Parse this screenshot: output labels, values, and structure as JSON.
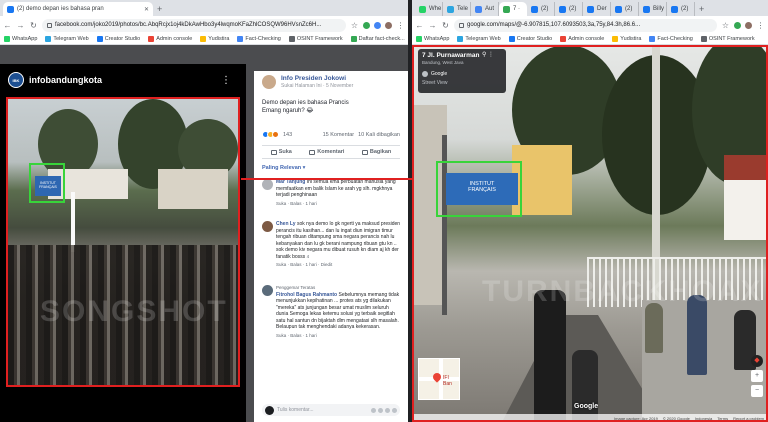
{
  "left_window": {
    "tabs": [
      {
        "label": "(2) demo depan ies bahasa pran",
        "active": true,
        "favicon_color": "#1877f2"
      }
    ],
    "url": "facebook.com/joko2019/photos/bc.AbqRcjx1oj4kDkAwHbo3y4lwqmoKFaZhlCOSQW96HVsnZc6H...",
    "bookmarks": [
      {
        "label": "WhatsApp",
        "color": "#25d366"
      },
      {
        "label": "Telegram Web",
        "color": "#2ca5e0"
      },
      {
        "label": "Creator Studio",
        "color": "#1877f2"
      },
      {
        "label": "Admin console",
        "color": "#ea4335"
      },
      {
        "label": "Yudistira",
        "color": "#fbbc05"
      },
      {
        "label": "Fact-Checking",
        "color": "#4285f4"
      },
      {
        "label": "OSINT Framework",
        "color": "#5f6368"
      },
      {
        "label": "Daftar fact-check...",
        "color": "#34a853"
      }
    ],
    "photo_page_name": "infobandungkota",
    "post": {
      "author": "Info Presiden Jokowi",
      "meta": "Sukai Halaman Ini · 5 November",
      "text_line1": "Demo depan ies bahasa Prancis",
      "text_line2": "Emang ngaruh? 😂",
      "reactions_count": "143",
      "comments_count": "15 Komentar",
      "shares_count": "10 Kali dibagikan",
      "action_like": "Suka",
      "action_comment": "Komentari",
      "action_share": "Bagikan",
      "sort_label": "Paling Relevan ▾",
      "comment_placeholder": "Tulis komentar..."
    },
    "comments": [
      {
        "name": "Mar Tanjung",
        "text": "Ini semua kma perbuatan manusia yang memfaatkan em balik Islam ke arah yg slh. mgkhnya terjadi penghinaan",
        "meta": "Suka · Balas · 1 hari"
      },
      {
        "name": "Chen Ly",
        "text": "sok nya demo lo gk ngerti ya maksud presiden perancis itu kasihan... dan lu ingat diun imigran timur tengah ribuan ditampung sma negara perancis nah lu kebanyakan dan lu gk berani nampung ribuan gtu kn .. sok demo kiv negara mu dibuat rusuh kn diam aj kh der fanatik bosss",
        "reacts": "4",
        "meta": "Suka · Balas · 1 hari · Diedit"
      },
      {
        "badge": "Penggemar Teratas",
        "name": "Fitrohol Bagus Rahmanto",
        "text": "Sebelumnya memang tidak menunjukkan kepihatinan ... protes ats yg dilakukan \"mereka\" ats junjungan besar umat muslim seluruh dunia Semoga lekas ketemu solusi yg terbaik segitlah satu hal santun dn bijaktah dlm mengatasi slh masalah. Belaupun tak menghendaki adanya kekerasan.",
        "meta": "Suka · Balas · 1 hari"
      }
    ]
  },
  "right_window": {
    "tabs": [
      {
        "label": "Whe",
        "favicon_color": "#25d366"
      },
      {
        "label": "Tele",
        "favicon_color": "#2ca5e0"
      },
      {
        "label": "Aut",
        "favicon_color": "#4285f4"
      },
      {
        "label": "7 ·",
        "favicon_color": "#34a853",
        "active": true
      },
      {
        "label": "(2)",
        "favicon_color": "#1877f2"
      },
      {
        "label": "(2)",
        "favicon_color": "#1877f2"
      },
      {
        "label": "Der",
        "favicon_color": "#1877f2"
      },
      {
        "label": "(2)",
        "favicon_color": "#1877f2"
      },
      {
        "label": "Billy",
        "favicon_color": "#1877f2"
      },
      {
        "label": "(2)",
        "favicon_color": "#1877f2"
      }
    ],
    "url": "google.com/maps/@-6.907815,107.6093503,3a,75y,84.3h,86.6...",
    "bookmarks": [
      {
        "label": "WhatsApp",
        "color": "#25d366"
      },
      {
        "label": "Telegram Web",
        "color": "#2ca5e0"
      },
      {
        "label": "Creator Studio",
        "color": "#1877f2"
      },
      {
        "label": "Admin console",
        "color": "#ea4335"
      },
      {
        "label": "Yudistira",
        "color": "#fbbc05"
      },
      {
        "label": "Fact-Checking",
        "color": "#4285f4"
      },
      {
        "label": "OSINT Framework",
        "color": "#5f6368"
      }
    ],
    "streetview": {
      "title": "7 Jl. Purnawarman",
      "subtitle": "Bandung, West Java",
      "provider": "Google",
      "street_view_label": "Street View",
      "sign_text_line1": "INSTITUT",
      "sign_text_line2": "FRANÇAIS",
      "minimap_label": "IFI Ban",
      "footer_date": "Image capture: Apr 2019",
      "footer_copyright": "© 2020 Google",
      "footer_country": "Indonesia",
      "footer_terms": "Terms",
      "footer_report": "Report a problem",
      "google_logo": "Google"
    }
  },
  "colors": {
    "red_highlight": "#e02020",
    "green_highlight": "#38d43a",
    "facebook_blue": "#385898",
    "sign_blue": "#2d6bb8"
  }
}
